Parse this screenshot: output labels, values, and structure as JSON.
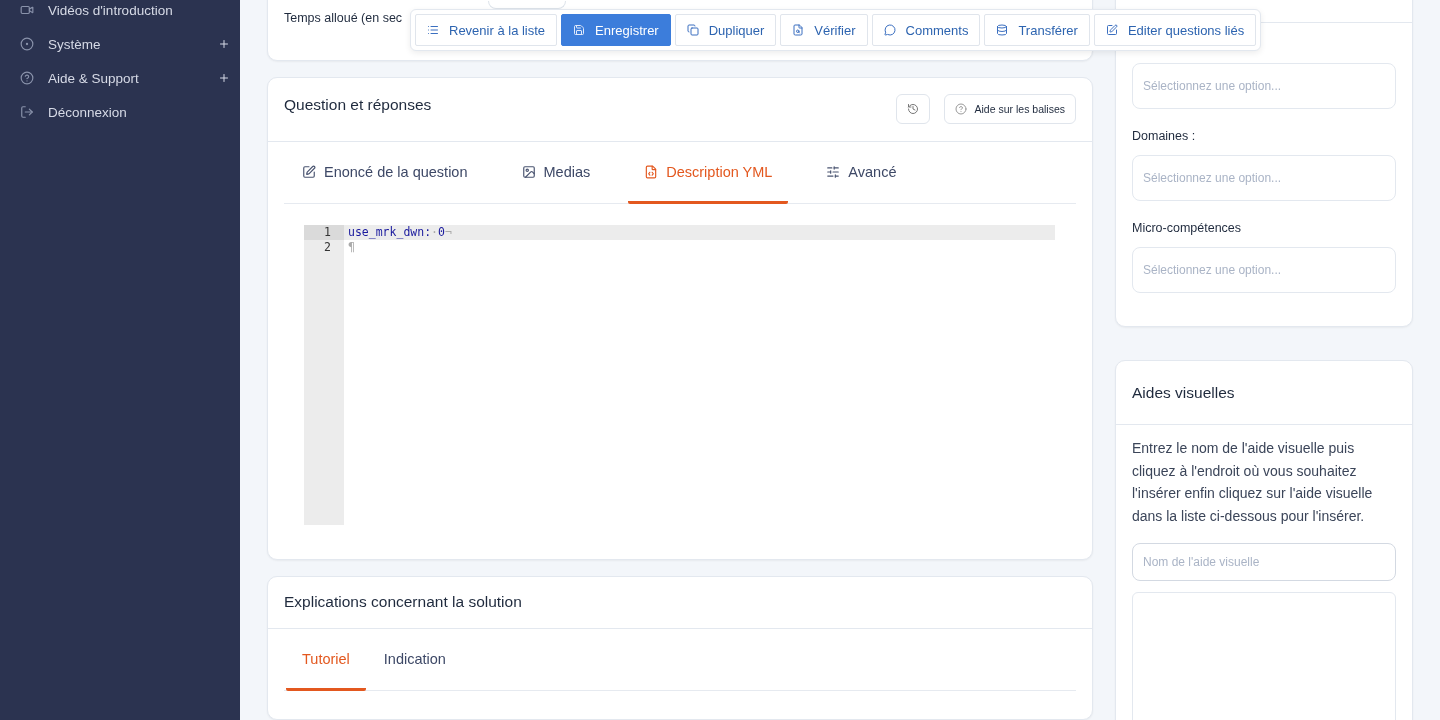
{
  "sidebar": {
    "items": [
      {
        "label": "Vidéos d'introduction",
        "expandable": false
      },
      {
        "label": "Système",
        "expandable": true
      },
      {
        "label": "Aide & Support",
        "expandable": true
      },
      {
        "label": "Déconnexion",
        "expandable": false
      }
    ]
  },
  "settings_card": {
    "field_label": "Temps alloué (en sec"
  },
  "toolbar": {
    "buttons": [
      {
        "label": "Revenir à la liste",
        "kind": "default"
      },
      {
        "label": "Enregistrer",
        "kind": "primary"
      },
      {
        "label": "Dupliquer",
        "kind": "default"
      },
      {
        "label": "Vérifier",
        "kind": "default"
      },
      {
        "label": "Comments",
        "kind": "default"
      },
      {
        "label": "Transférer",
        "kind": "default"
      },
      {
        "label": "Editer questions liés",
        "kind": "default"
      }
    ]
  },
  "question_card": {
    "title": "Question et réponses",
    "help_button": "Aide sur les balises",
    "tabs": [
      {
        "label": "Enoncé de la question",
        "selected": false
      },
      {
        "label": "Medias",
        "selected": false
      },
      {
        "label": "Description YML",
        "selected": true
      },
      {
        "label": "Avancé",
        "selected": false
      }
    ],
    "editor": {
      "lines": [
        {
          "number": "1",
          "key": "use_mrk_dwn:",
          "space_mark": "·",
          "value": "0",
          "end_mark": "¬",
          "highlighted": true
        },
        {
          "number": "2",
          "end_mark": "¶",
          "highlighted": false
        }
      ]
    }
  },
  "solution_card": {
    "title": "Explications concernant la solution",
    "tabs": [
      {
        "label": "Tutoriel",
        "selected": true
      },
      {
        "label": "Indication",
        "selected": false
      }
    ]
  },
  "taxonomy_card": {
    "fields": [
      {
        "placeholder": "Sélectionnez une option..."
      },
      {
        "label": "Domaines :",
        "placeholder": "Sélectionnez une option..."
      },
      {
        "label": "Micro-compétences",
        "placeholder": "Sélectionnez une option..."
      }
    ]
  },
  "visual_aids_card": {
    "title": "Aides visuelles",
    "instructions": "Entrez le nom de l'aide visuelle puis cliquez à l'endroit où vous souhaitez l'insérer enfin cliquez sur l'aide visuelle dans la liste ci-dessous pour l'insérer.",
    "name_field": {
      "placeholder": "Nom de l'aide visuelle"
    }
  }
}
